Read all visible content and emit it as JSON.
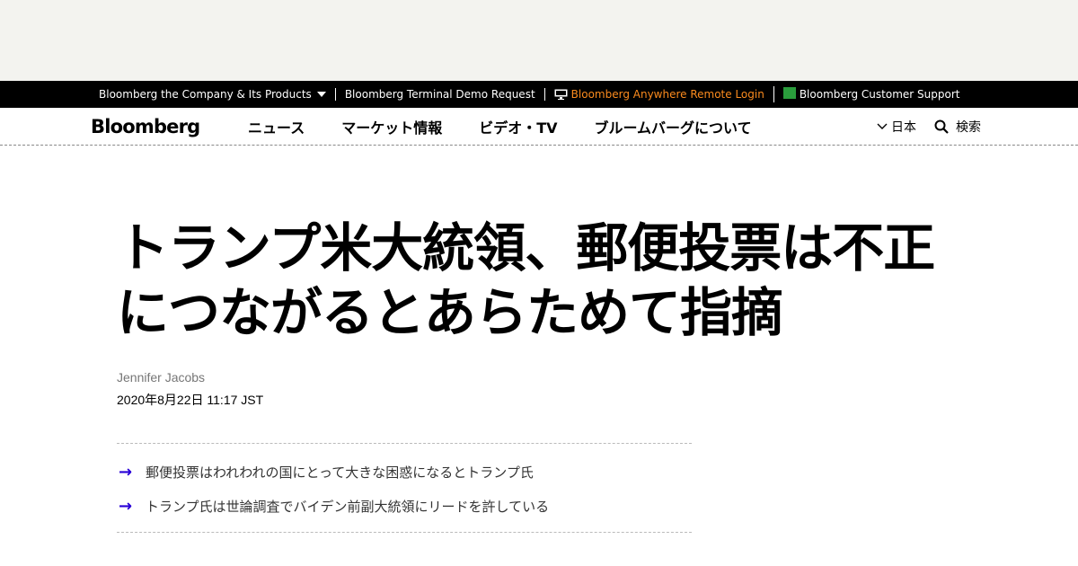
{
  "topbar": {
    "company_label": "Bloomberg the Company & Its Products",
    "terminal_label": "Bloomberg Terminal Demo Request",
    "anywhere_label": "Bloomberg Anywhere Remote Login",
    "support_label": "Bloomberg Customer Support"
  },
  "navbar": {
    "logo": "Bloomberg",
    "items": [
      {
        "label": "ニュース"
      },
      {
        "label": "マーケット情報"
      },
      {
        "label": "ビデオ・TV"
      },
      {
        "label": "ブルームバーグについて"
      }
    ],
    "language": "日本",
    "search_label": "検索"
  },
  "article": {
    "headline_line1": "トランプ米大統領、郵便投票は不正",
    "headline_line2": "につながるとあらためて指摘",
    "author": "Jennifer Jacobs",
    "date": "2020年8月22日 11:17 JST",
    "summary": [
      {
        "text": "郵便投票はわれわれの国にとって大きな困惑になるとトランプ氏"
      },
      {
        "text": "トランプ氏は世論調査でバイデン前副大統領にリードを許している"
      }
    ]
  },
  "colors": {
    "accent_orange": "#fb8b1e",
    "arrow_blue": "#2800d7",
    "topbar_bg": "#000000",
    "ad_band_bg": "#f3f3ef"
  }
}
